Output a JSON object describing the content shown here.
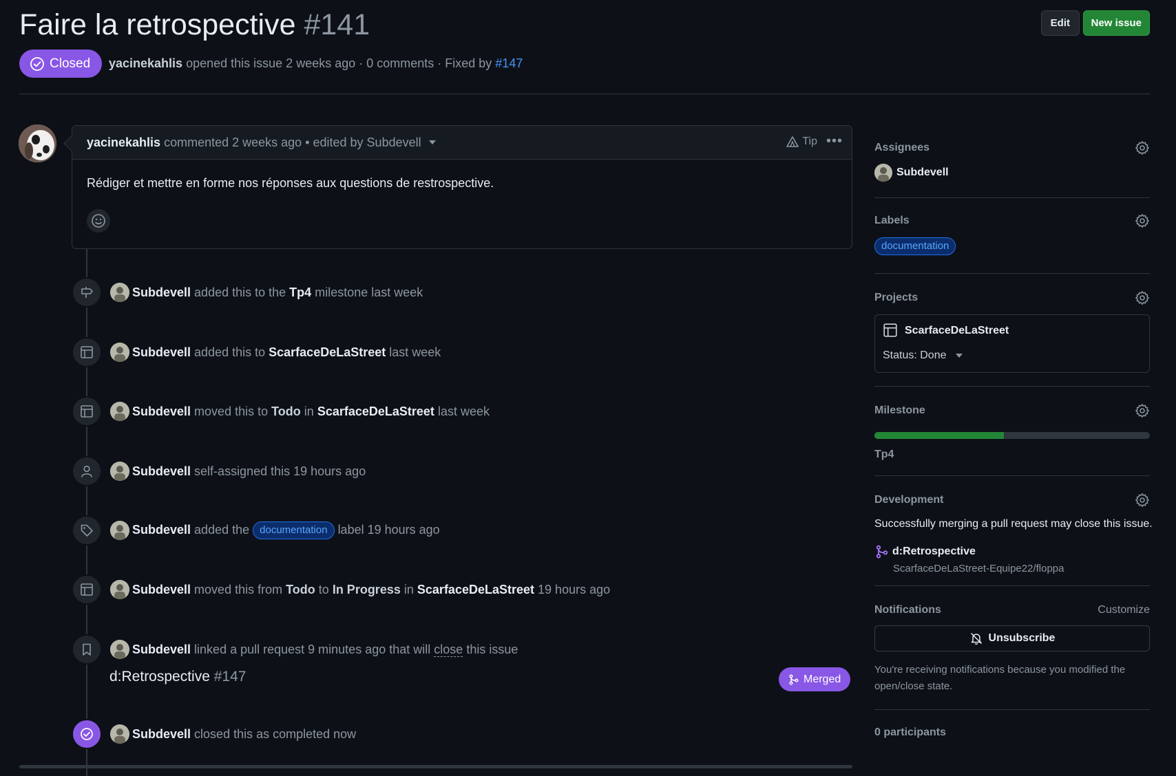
{
  "issue": {
    "title": "Faire la retrospective",
    "number": "#141",
    "state": "Closed",
    "author": "yacinekahlis",
    "meta_opened": " opened this issue 2 weeks ago · 0 comments · Fixed by ",
    "fixed_by": "#147"
  },
  "header_buttons": {
    "edit": "Edit",
    "new_issue": "New issue"
  },
  "comment": {
    "author": "yacinekahlis",
    "meta": "commented 2 weeks ago • edited by Subdevell",
    "tip": "Tip",
    "body": "Rédiger et mettre en forme nos réponses aux questions de restrospective."
  },
  "timeline": {
    "user": "Subdevell",
    "e1": {
      "t1": "added this to the",
      "milestone": "Tp4",
      "t2": "milestone last week"
    },
    "e2": {
      "t1": "added this to",
      "project": "ScarfaceDeLaStreet",
      "t2": "last week"
    },
    "e3": {
      "t1": "moved this to",
      "col": "Todo",
      "t2": "in",
      "project": "ScarfaceDeLaStreet",
      "t3": "last week"
    },
    "e4": {
      "t1": "self-assigned this 19 hours ago"
    },
    "e5": {
      "t1": "added the",
      "label": "documentation",
      "t2": "label 19 hours ago"
    },
    "e6": {
      "t1": "moved this from",
      "from": "Todo",
      "t2": "to",
      "to": "In Progress",
      "t3": "in",
      "project": "ScarfaceDeLaStreet",
      "t4": "19 hours ago"
    },
    "e7": {
      "t1": "linked a pull request 9 minutes ago that will",
      "close": "close",
      "t2": "this issue"
    },
    "pr": {
      "title": "d:Retrospective",
      "number": "#147",
      "status": "Merged"
    },
    "e8": {
      "t1": "closed this as completed now"
    }
  },
  "sidebar": {
    "assignees": {
      "title": "Assignees",
      "user": "Subdevell"
    },
    "labels": {
      "title": "Labels",
      "label": "documentation"
    },
    "projects": {
      "title": "Projects",
      "name": "ScarfaceDeLaStreet",
      "status": "Status: Done"
    },
    "milestone": {
      "title": "Milestone",
      "name": "Tp4",
      "progress_pct": 47
    },
    "development": {
      "title": "Development",
      "text": "Successfully merging a pull request may close this issue.",
      "branch": "d:Retrospective",
      "repo": "ScarfaceDeLaStreet-Equipe22/floppa"
    },
    "notifications": {
      "title": "Notifications",
      "customize": "Customize",
      "button": "Unsubscribe",
      "reason": "You're receiving notifications because you modified the open/close state."
    },
    "participants": "0 participants"
  },
  "colors": {
    "accent_purple": "#8957e5",
    "green": "#238636",
    "link": "#4493f8",
    "bg": "#0d1117"
  }
}
